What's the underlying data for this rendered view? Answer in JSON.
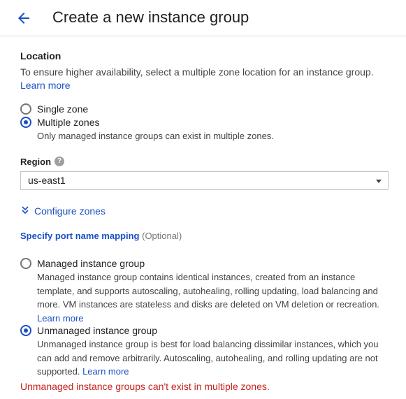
{
  "header": {
    "title": "Create a new instance group"
  },
  "location": {
    "title": "Location",
    "description": "To ensure higher availability, select a multiple zone location for an instance group.",
    "learn_more": "Learn more",
    "options": [
      {
        "label": "Single zone",
        "selected": false
      },
      {
        "label": "Multiple zones",
        "selected": true,
        "help": "Only managed instance groups can exist in multiple zones."
      }
    ]
  },
  "region": {
    "label": "Region",
    "help_icon": "?",
    "value": "us-east1"
  },
  "configure_zones": {
    "label": "Configure zones"
  },
  "port_mapping": {
    "label": "Specify port name mapping",
    "optional": "(Optional)"
  },
  "group_type": {
    "options": [
      {
        "label": "Managed instance group",
        "selected": false,
        "description": "Managed instance group contains identical instances, created from an instance template, and supports autoscaling, autohealing, rolling updating, load balancing and more. VM instances are stateless and disks are deleted on VM deletion or recreation.",
        "learn_more": "Learn more"
      },
      {
        "label": "Unmanaged instance group",
        "selected": true,
        "description": "Unmanaged instance group is best for load balancing dissimilar instances, which you can add and remove arbitrarily. Autoscaling, autohealing, and rolling updating are not supported.",
        "learn_more": "Learn more"
      }
    ]
  },
  "error": "Unmanaged instance groups can't exist in multiple zones.",
  "colors": {
    "link": "#1a4fc4",
    "error": "#c5221f"
  }
}
